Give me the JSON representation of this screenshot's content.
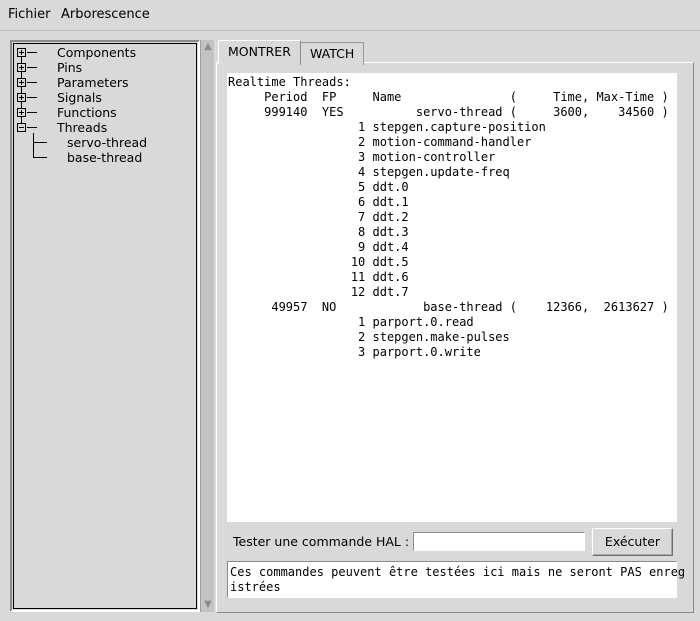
{
  "menu": {
    "file": "Fichier",
    "tree": "Arborescence"
  },
  "tree": {
    "items": [
      {
        "label": "Components",
        "expanded": false
      },
      {
        "label": "Pins",
        "expanded": false
      },
      {
        "label": "Parameters",
        "expanded": false
      },
      {
        "label": "Signals",
        "expanded": false
      },
      {
        "label": "Functions",
        "expanded": false
      },
      {
        "label": "Threads",
        "expanded": true
      }
    ],
    "children": [
      "servo-thread",
      "base-thread"
    ]
  },
  "tabs": {
    "show": "MONTRER",
    "watch": "WATCH"
  },
  "output": {
    "lines": [
      "Realtime Threads:",
      "     Period  FP     Name               (     Time, Max-Time )",
      "     999140  YES          servo-thread (     3600,    34560 )",
      "                  1 stepgen.capture-position",
      "                  2 motion-command-handler",
      "                  3 motion-controller",
      "                  4 stepgen.update-freq",
      "                  5 ddt.0",
      "                  6 ddt.1",
      "                  7 ddt.2",
      "                  8 ddt.3",
      "                  9 ddt.4",
      "                 10 ddt.5",
      "                 11 ddt.6",
      "                 12 ddt.7",
      "      49957  NO            base-thread (    12366,  2613627 )",
      "                  1 parport.0.read",
      "                  2 stepgen.make-pulses",
      "                  3 parport.0.write"
    ]
  },
  "hal": {
    "label": "Tester une commande HAL :",
    "input_value": "",
    "execute_label": "Exécuter"
  },
  "info": {
    "line1": "Ces commandes peuvent être testées ici mais ne seront PAS enreg",
    "line2": "istrées"
  },
  "colors": {
    "background": "#d9d9d9",
    "output_background": "#ffffff"
  }
}
